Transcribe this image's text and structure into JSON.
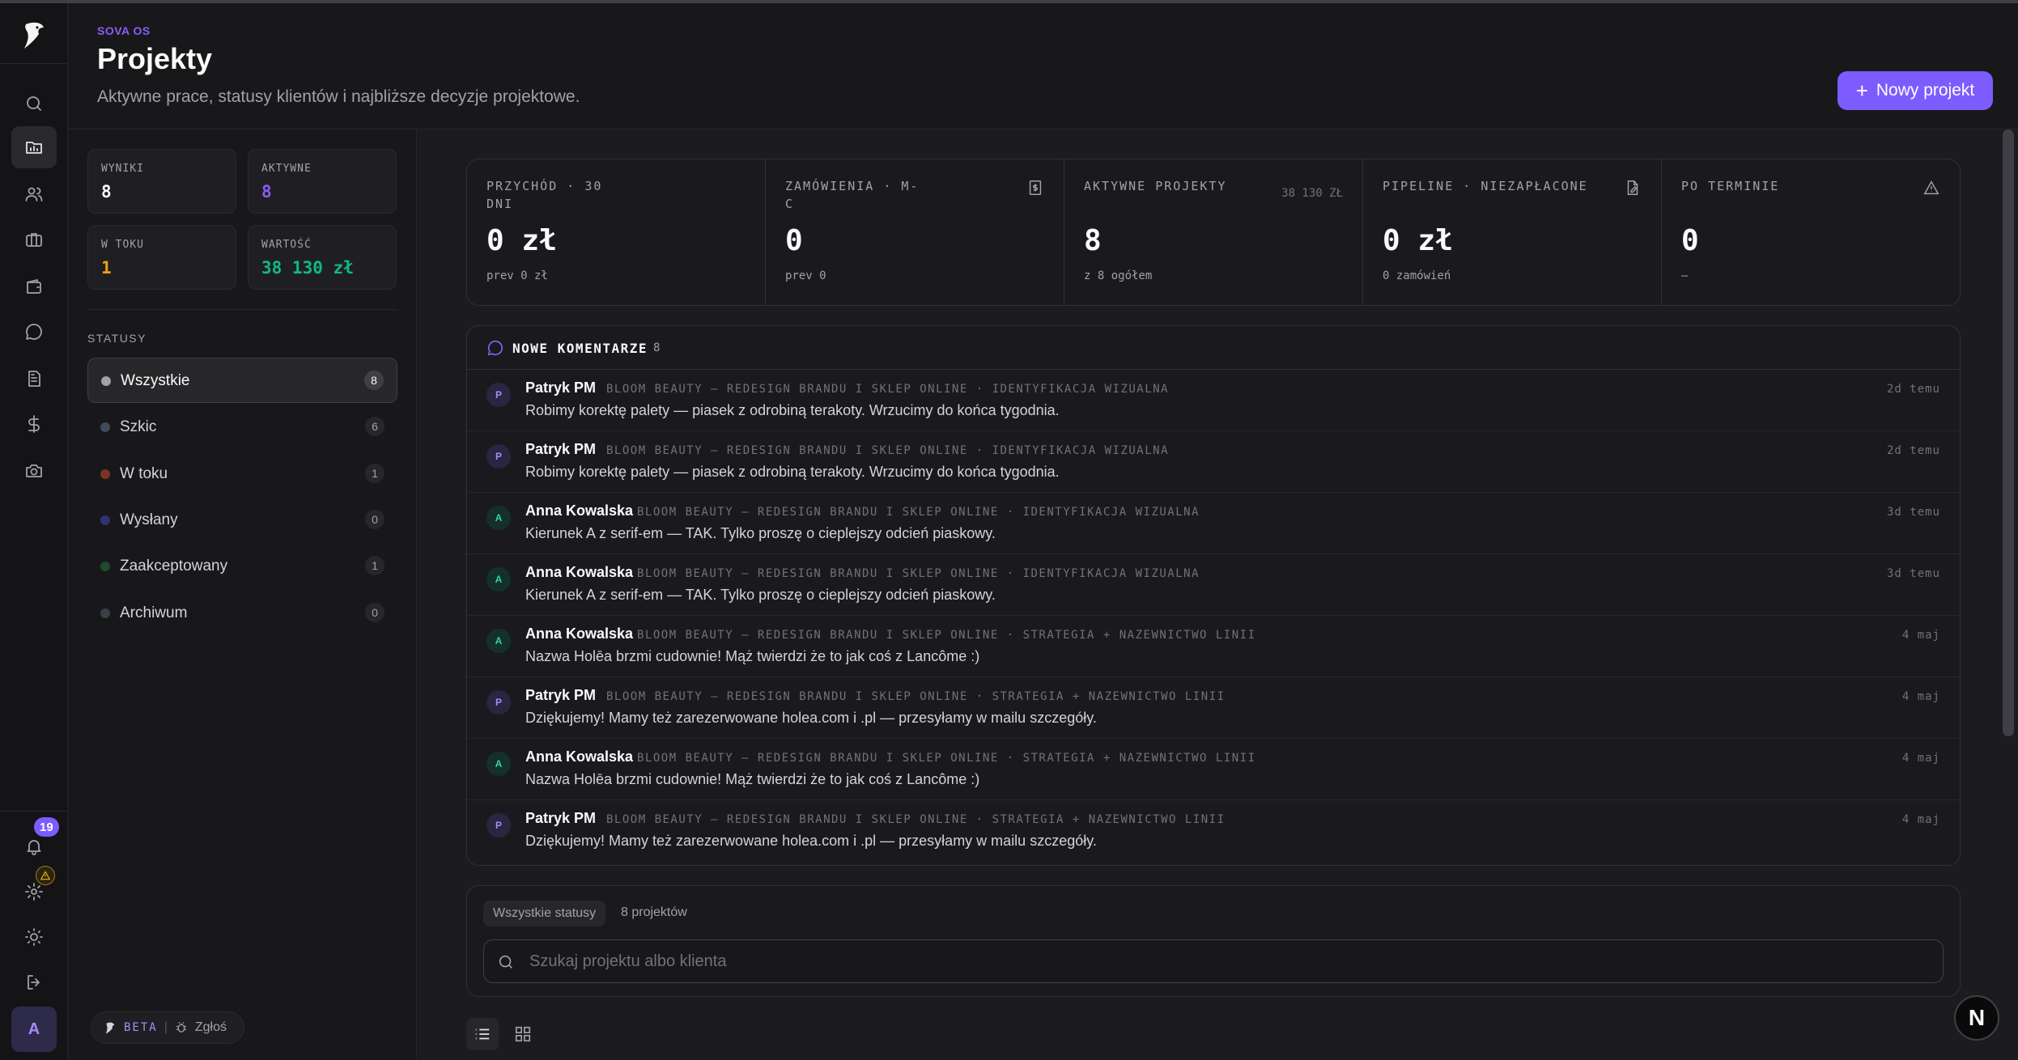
{
  "header": {
    "eyebrow": "SOVA OS",
    "title": "Projekty",
    "subtitle": "Aktywne prace, statusy klientów i najbliższe decyzje projektowe.",
    "new_button": "Nowy projekt"
  },
  "rail": {
    "icons": [
      "search-icon",
      "projects-icon",
      "users-icon",
      "briefcase-icon",
      "wallet-icon",
      "chat-icon",
      "document-icon",
      "dollar-icon",
      "camera-icon"
    ],
    "notifications_count": "19",
    "avatar_letter": "A"
  },
  "side": {
    "stats": [
      {
        "label": "WYNIKI",
        "value": "8",
        "color": "#fafafa"
      },
      {
        "label": "AKTYWNE",
        "value": "8",
        "color": "#8b5cf6"
      },
      {
        "label": "W TOKU",
        "value": "1",
        "color": "#f59e0b"
      },
      {
        "label": "WARTOŚĆ",
        "value": "38 130 zł",
        "color": "#10b981"
      }
    ],
    "statuses_title": "STATUSY",
    "statuses": [
      {
        "name": "Wszystkie",
        "count": "8",
        "color": "#a1a1aa"
      },
      {
        "name": "Szkic",
        "count": "6",
        "color": "#3f4a5a"
      },
      {
        "name": "W toku",
        "count": "1",
        "color": "#7a3522"
      },
      {
        "name": "Wysłany",
        "count": "0",
        "color": "#2d3470"
      },
      {
        "name": "Zaakceptowany",
        "count": "1",
        "color": "#1e4a30"
      },
      {
        "name": "Archiwum",
        "count": "0",
        "color": "#3a3f4a"
      }
    ],
    "beta_label": "BETA",
    "report_label": "Zgłoś"
  },
  "kpis": [
    {
      "label": "PRZYCHÓD · 30 DNI",
      "value": "0 zł",
      "sub": "prev 0 zł",
      "aside": "",
      "icon": ""
    },
    {
      "label": "ZAMÓWIENIA · M-C",
      "value": "0",
      "sub": "prev 0",
      "aside": "",
      "icon": "invoice-icon"
    },
    {
      "label": "AKTYWNE PROJEKTY",
      "value": "8",
      "sub": "z 8 ogółem",
      "aside": "38 130 ZŁ",
      "icon": ""
    },
    {
      "label": "PIPELINE · NIEZAPŁACONE",
      "value": "0 zł",
      "sub": "0 zamówień",
      "aside": "",
      "icon": "edit-doc-icon"
    },
    {
      "label": "PO TERMINIE",
      "value": "0",
      "sub": "—",
      "aside": "",
      "icon": "warning-icon"
    }
  ],
  "comments": {
    "title": "NOWE KOMENTARZE",
    "count": "8",
    "items": [
      {
        "initial": "P",
        "kind": "p",
        "author": "Patryk PM",
        "context": "BLOOM BEAUTY — REDESIGN BRANDU I SKLEP ONLINE · IDENTYFIKACJA WIZUALNA",
        "message": "Robimy korektę palety — piasek z odrobiną terakoty. Wrzucimy do końca tygodnia.",
        "time": "2d temu"
      },
      {
        "initial": "P",
        "kind": "p",
        "author": "Patryk PM",
        "context": "BLOOM BEAUTY — REDESIGN BRANDU I SKLEP ONLINE · IDENTYFIKACJA WIZUALNA",
        "message": "Robimy korektę palety — piasek z odrobiną terakoty. Wrzucimy do końca tygodnia.",
        "time": "2d temu"
      },
      {
        "initial": "A",
        "kind": "a",
        "author": "Anna Kowalska",
        "context": "BLOOM BEAUTY — REDESIGN BRANDU I SKLEP ONLINE · IDENTYFIKACJA WIZUALNA",
        "message": "Kierunek A z serif-em — TAK. Tylko proszę o cieplejszy odcień piaskowy.",
        "time": "3d temu"
      },
      {
        "initial": "A",
        "kind": "a",
        "author": "Anna Kowalska",
        "context": "BLOOM BEAUTY — REDESIGN BRANDU I SKLEP ONLINE · IDENTYFIKACJA WIZUALNA",
        "message": "Kierunek A z serif-em — TAK. Tylko proszę o cieplejszy odcień piaskowy.",
        "time": "3d temu"
      },
      {
        "initial": "A",
        "kind": "a",
        "author": "Anna Kowalska",
        "context": "BLOOM BEAUTY — REDESIGN BRANDU I SKLEP ONLINE · STRATEGIA + NAZEWNICTWO LINII",
        "message": "Nazwa Holēa brzmi cudownie! Mąż twierdzi że to jak coś z Lancôme :)",
        "time": "4 maj"
      },
      {
        "initial": "P",
        "kind": "p",
        "author": "Patryk PM",
        "context": "BLOOM BEAUTY — REDESIGN BRANDU I SKLEP ONLINE · STRATEGIA + NAZEWNICTWO LINII",
        "message": "Dziękujemy! Mamy też zarezerwowane holea.com i .pl — przesyłamy w mailu szczegóły.",
        "time": "4 maj"
      },
      {
        "initial": "A",
        "kind": "a",
        "author": "Anna Kowalska",
        "context": "BLOOM BEAUTY — REDESIGN BRANDU I SKLEP ONLINE · STRATEGIA + NAZEWNICTWO LINII",
        "message": "Nazwa Holēa brzmi cudownie! Mąż twierdzi że to jak coś z Lancôme :)",
        "time": "4 maj"
      },
      {
        "initial": "P",
        "kind": "p",
        "author": "Patryk PM",
        "context": "BLOOM BEAUTY — REDESIGN BRANDU I SKLEP ONLINE · STRATEGIA + NAZEWNICTWO LINII",
        "message": "Dziękujemy! Mamy też zarezerwowane holea.com i .pl — przesyłamy w mailu szczegóły.",
        "time": "4 maj"
      }
    ]
  },
  "filters": {
    "status_chip": "Wszystkie statusy",
    "project_count": "8 projektów",
    "search_placeholder": "Szukaj projektu albo klienta"
  },
  "assistant_bubble": "N"
}
